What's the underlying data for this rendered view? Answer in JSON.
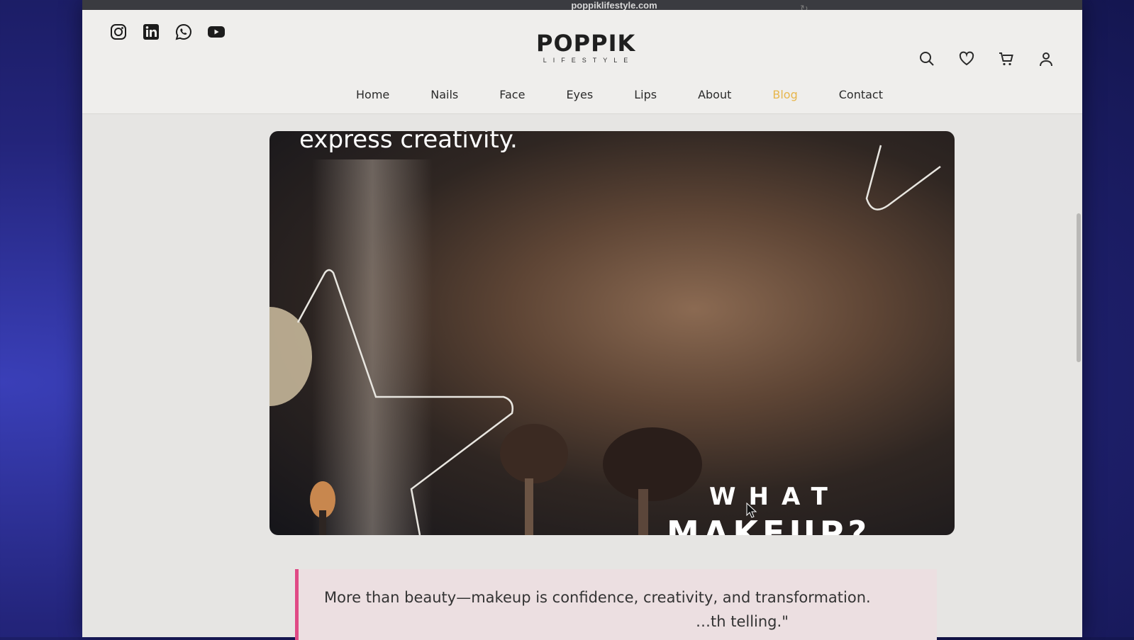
{
  "browser": {
    "url": "poppiklifestyle.com"
  },
  "header": {
    "social_icons": [
      "instagram-icon",
      "linkedin-icon",
      "whatsapp-icon",
      "youtube-icon"
    ],
    "logo_main": "POPPIK",
    "logo_sub": "LIFESTYLE",
    "action_icons": [
      "search-icon",
      "heart-icon",
      "cart-icon",
      "user-icon"
    ]
  },
  "nav": {
    "items": [
      {
        "label": "Home"
      },
      {
        "label": "Nails"
      },
      {
        "label": "Face"
      },
      {
        "label": "Eyes"
      },
      {
        "label": "Lips"
      },
      {
        "label": "About"
      },
      {
        "label": "Blog",
        "active": true
      },
      {
        "label": "Contact"
      }
    ],
    "active_color": "#e7b64c"
  },
  "hero": {
    "headline": "express creativity.",
    "overlay_what": "WHAT",
    "overlay_makeup": "MAKEUP?"
  },
  "quote": {
    "line1": "More than beauty—makeup is confidence, creativity, and transformation.",
    "line2": "…th telling.\"",
    "accent_color": "#e04a86"
  }
}
